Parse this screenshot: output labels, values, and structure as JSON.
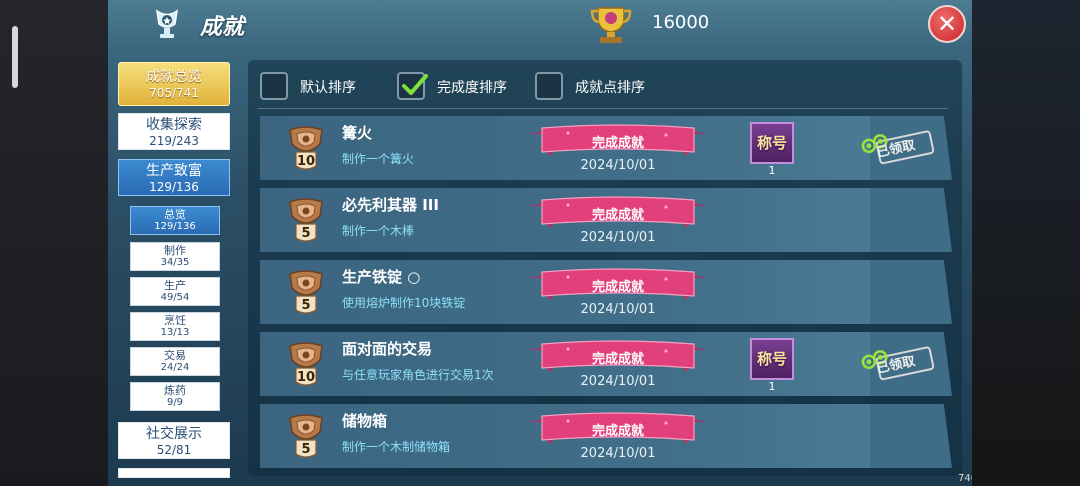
{
  "header": {
    "title": "成就",
    "points": "16000"
  },
  "nav": {
    "overview": {
      "label": "成就总览",
      "count": "705/741"
    },
    "items": [
      {
        "label": "收集探索",
        "count": "219/243"
      },
      {
        "label": "生产致富",
        "count": "129/136"
      }
    ],
    "sub_items": [
      {
        "label": "总览",
        "count": "129/136"
      },
      {
        "label": "制作",
        "count": "34/35"
      },
      {
        "label": "生产",
        "count": "49/54"
      },
      {
        "label": "烹饪",
        "count": "13/13"
      },
      {
        "label": "交易",
        "count": "24/24"
      },
      {
        "label": "炼药",
        "count": "9/9"
      }
    ],
    "social": {
      "label": "社交展示",
      "count": "52/81"
    }
  },
  "sort_options": [
    {
      "label": "默认排序",
      "checked": false
    },
    {
      "label": "完成度排序",
      "checked": true
    },
    {
      "label": "成就点排序",
      "checked": false
    }
  ],
  "achievements": [
    {
      "name": "篝火",
      "desc": "制作一个篝火",
      "points": "10",
      "status": "完成成就",
      "date": "2024/10/01",
      "reward_label": "称号",
      "reward_count": "1",
      "claimed": "已领取"
    },
    {
      "name": "必先利其器 III",
      "desc": "制作一个木棒",
      "points": "5",
      "status": "完成成就",
      "date": "2024/10/01"
    },
    {
      "name": "生产铁锭 ○",
      "desc": "使用熔炉制作10块铁锭",
      "points": "5",
      "status": "完成成就",
      "date": "2024/10/01"
    },
    {
      "name": "面对面的交易",
      "desc": "与任意玩家角色进行交易1次",
      "points": "10",
      "status": "完成成就",
      "date": "2024/10/01",
      "reward_label": "称号",
      "reward_count": "1",
      "claimed": "已领取"
    },
    {
      "name": "储物箱",
      "desc": "制作一个木制储物箱",
      "points": "5",
      "status": "完成成就",
      "date": "2024/10/01"
    }
  ],
  "footer": {
    "version": "740300000005"
  },
  "colors": {
    "accent": "#e0b23b",
    "active_tab": "#2a6bb3",
    "ribbon": "#e2407a",
    "close": "#c9262a"
  }
}
